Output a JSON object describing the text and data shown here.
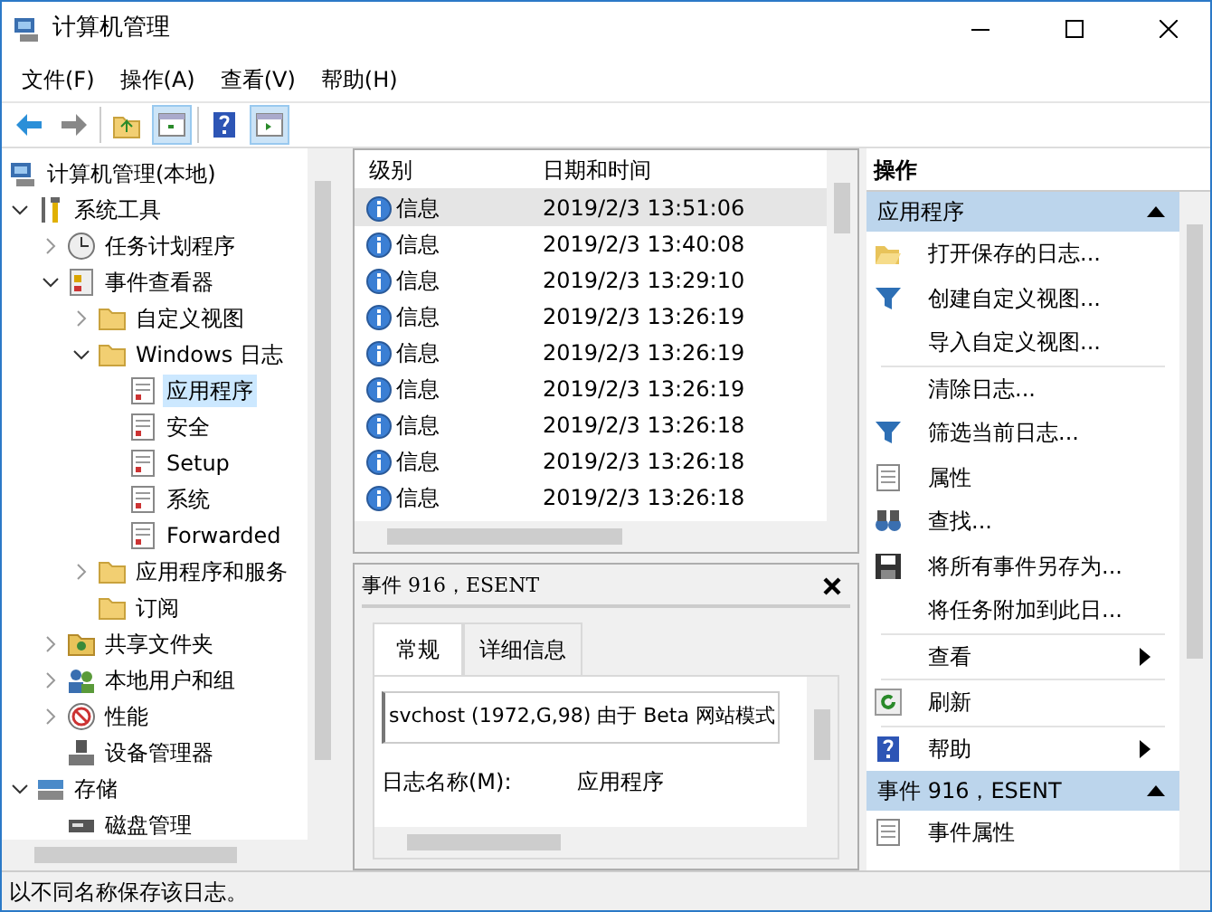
{
  "window": {
    "title": "计算机管理"
  },
  "menu": [
    "文件(F)",
    "操作(A)",
    "查看(V)",
    "帮助(H)"
  ],
  "tree": [
    {
      "label": "计算机管理(本地)",
      "kind": "computer",
      "selected": false,
      "children": [
        {
          "label": "系统工具",
          "kind": "tools",
          "expanded": true,
          "selected": false,
          "children": [
            {
              "label": "任务计划程序",
              "kind": "clock",
              "expanded": false,
              "selected": false
            },
            {
              "label": "事件查看器",
              "kind": "viewer",
              "expanded": true,
              "selected": false,
              "children": [
                {
                  "label": "自定义视图",
                  "kind": "folder",
                  "expanded": false,
                  "selected": false
                },
                {
                  "label": "Windows 日志",
                  "kind": "folder",
                  "expanded": true,
                  "selected": false,
                  "children": [
                    {
                      "label": "应用程序",
                      "kind": "log",
                      "selected": true
                    },
                    {
                      "label": "安全",
                      "kind": "log",
                      "selected": false
                    },
                    {
                      "label": "Setup",
                      "kind": "log",
                      "selected": false
                    },
                    {
                      "label": "系统",
                      "kind": "log",
                      "selected": false
                    },
                    {
                      "label": "Forwarded",
                      "kind": "log",
                      "selected": false
                    }
                  ]
                },
                {
                  "label": "应用程序和服务",
                  "kind": "folder",
                  "expanded": false,
                  "selected": false
                },
                {
                  "label": "订阅",
                  "kind": "folder",
                  "selected": false
                }
              ]
            },
            {
              "label": "共享文件夹",
              "kind": "share",
              "expanded": false,
              "selected": false
            },
            {
              "label": "本地用户和组",
              "kind": "users",
              "expanded": false,
              "selected": false
            },
            {
              "label": "性能",
              "kind": "perf",
              "expanded": false,
              "selected": false
            },
            {
              "label": "设备管理器",
              "kind": "device",
              "selected": false
            }
          ]
        },
        {
          "label": "存储",
          "kind": "storage",
          "expanded": true,
          "selected": false,
          "children": [
            {
              "label": "磁盘管理",
              "kind": "disk",
              "selected": false
            }
          ]
        }
      ]
    }
  ],
  "events": {
    "columns": [
      "级别",
      "日期和时间"
    ],
    "rows": [
      {
        "level": "信息",
        "datetime": "2019/2/3 13:51:06",
        "selected": true
      },
      {
        "level": "信息",
        "datetime": "2019/2/3 13:40:08",
        "selected": false
      },
      {
        "level": "信息",
        "datetime": "2019/2/3 13:29:10",
        "selected": false
      },
      {
        "level": "信息",
        "datetime": "2019/2/3 13:26:19",
        "selected": false
      },
      {
        "level": "信息",
        "datetime": "2019/2/3 13:26:19",
        "selected": false
      },
      {
        "level": "信息",
        "datetime": "2019/2/3 13:26:19",
        "selected": false
      },
      {
        "level": "信息",
        "datetime": "2019/2/3 13:26:18",
        "selected": false
      },
      {
        "level": "信息",
        "datetime": "2019/2/3 13:26:18",
        "selected": false
      },
      {
        "level": "信息",
        "datetime": "2019/2/3 13:26:18",
        "selected": false
      }
    ]
  },
  "detail": {
    "title": "事件 916，ESENT",
    "tabs": [
      {
        "label": "常规",
        "selected": true
      },
      {
        "label": "详细信息",
        "selected": false
      }
    ],
    "description": "svchost (1972,G,98) 由于 Beta 网站模式",
    "fields": [
      {
        "label": "日志名称(M):",
        "value": "应用程序"
      }
    ]
  },
  "actions": {
    "title": "操作",
    "sections": [
      {
        "title": "应用程序",
        "expanded": true,
        "items": [
          {
            "label": "打开保存的日志...",
            "kind": "open"
          },
          {
            "label": "创建自定义视图...",
            "kind": "filter"
          },
          {
            "label": "导入自定义视图...",
            "kind": "none"
          },
          {
            "kind": "separator"
          },
          {
            "label": "清除日志...",
            "kind": "none"
          },
          {
            "label": "筛选当前日志...",
            "kind": "filter"
          },
          {
            "label": "属性",
            "kind": "props"
          },
          {
            "label": "查找...",
            "kind": "find"
          },
          {
            "label": "将所有事件另存为...",
            "kind": "save"
          },
          {
            "label": "将任务附加到此日...",
            "kind": "none"
          },
          {
            "kind": "separator"
          },
          {
            "label": "查看",
            "kind": "submenu"
          },
          {
            "kind": "separator"
          },
          {
            "label": "刷新",
            "kind": "refresh"
          },
          {
            "kind": "separator"
          },
          {
            "label": "帮助",
            "kind": "help"
          }
        ]
      },
      {
        "title": "事件 916，ESENT",
        "expanded": true,
        "items": [
          {
            "label": "事件属性",
            "kind": "props"
          }
        ]
      }
    ]
  },
  "status_bar": "以不同名称保存该日志。"
}
